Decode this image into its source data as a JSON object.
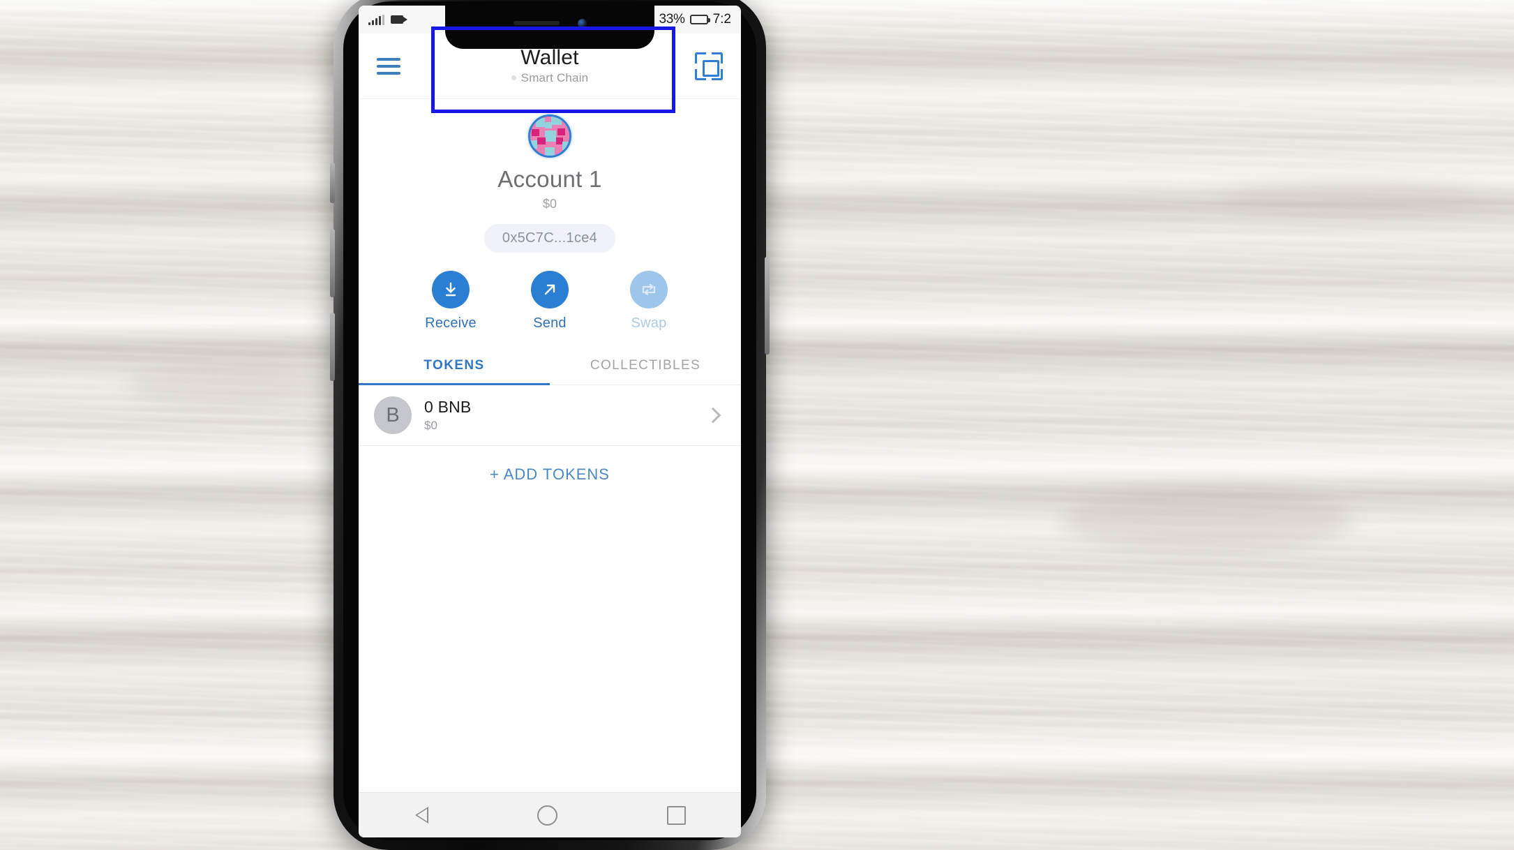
{
  "status_bar": {
    "signal_icon": "signal-bars-icon",
    "camera_icon": "video-camera-icon",
    "battery_percent": "33%",
    "battery_icon": "battery-icon",
    "clock": "7:2"
  },
  "header": {
    "menu_icon": "hamburger-menu-icon",
    "title": "Wallet",
    "subtitle": "Smart Chain",
    "network_dot": "network-status-dot",
    "scan_icon": "qr-scan-icon"
  },
  "account": {
    "avatar_icon": "identicon-avatar",
    "name": "Account 1",
    "fiat_balance": "$0",
    "address": "0x5C7C...1ce4"
  },
  "actions": [
    {
      "label": "Receive",
      "icon": "download-arrow-icon",
      "disabled": false
    },
    {
      "label": "Send",
      "icon": "arrow-up-right-icon",
      "disabled": false
    },
    {
      "label": "Swap",
      "icon": "swap-arrows-icon",
      "disabled": true
    }
  ],
  "tabs": [
    {
      "label": "TOKENS",
      "active": true
    },
    {
      "label": "COLLECTIBLES",
      "active": false
    }
  ],
  "tokens": [
    {
      "logo_letter": "B",
      "amount": "0 BNB",
      "fiat": "$0",
      "chevron": "chevron-right-icon"
    }
  ],
  "add_tokens_label": "+ ADD TOKENS",
  "nav_bar": {
    "back": "back-triangle-icon",
    "home": "home-circle-icon",
    "recents": "recents-square-icon"
  },
  "colors": {
    "accent_blue": "#2a7fd4",
    "tab_blue": "#2f76c4",
    "disabled_blue": "#9dc6ea",
    "highlight": "#1717e6",
    "muted_gray": "#9a9aa0",
    "pill_bg": "#eff2f9"
  }
}
